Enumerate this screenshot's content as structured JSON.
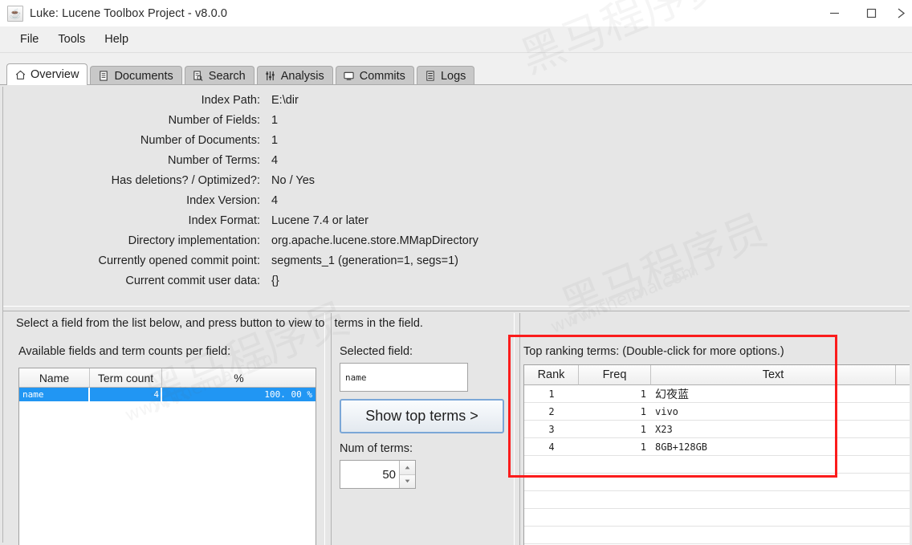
{
  "window": {
    "title": "Luke: Lucene Toolbox Project - v8.0.0",
    "app_icon": "java-coffee-icon",
    "controls": {
      "minimize": "minimize-button",
      "maximize": "maximize-button",
      "close": "close-button"
    }
  },
  "menubar": {
    "items": [
      {
        "label": "File"
      },
      {
        "label": "Tools"
      },
      {
        "label": "Help"
      }
    ]
  },
  "tabs": [
    {
      "label": "Overview",
      "icon": "home-icon",
      "active": true
    },
    {
      "label": "Documents",
      "icon": "document-icon",
      "active": false
    },
    {
      "label": "Search",
      "icon": "search-doc-icon",
      "active": false
    },
    {
      "label": "Analysis",
      "icon": "sliders-icon",
      "active": false
    },
    {
      "label": "Commits",
      "icon": "monitor-icon",
      "active": false
    },
    {
      "label": "Logs",
      "icon": "logs-icon",
      "active": false
    }
  ],
  "overview": {
    "info_rows": [
      {
        "label": "Index Path:",
        "value": "E:\\dir"
      },
      {
        "label": "Number of Fields:",
        "value": "1"
      },
      {
        "label": "Number of Documents:",
        "value": "1"
      },
      {
        "label": "Number of Terms:",
        "value": "4"
      },
      {
        "label": "Has deletions? / Optimized?:",
        "value": "No / Yes"
      },
      {
        "label": "Index Version:",
        "value": "4"
      },
      {
        "label": "Index Format:",
        "value": "Lucene 7.4 or later"
      },
      {
        "label": "Directory implementation:",
        "value": "org.apache.lucene.store.MMapDirectory"
      },
      {
        "label": "Currently opened commit point:",
        "value": "segments_1 (generation=1, segs=1)"
      },
      {
        "label": "Current commit user data:",
        "value": "{}"
      }
    ],
    "hint": "Select a field from the list below, and press button to view top terms in the field.",
    "fields_panel": {
      "label": "Available fields and term counts per field:",
      "columns": [
        "Name",
        "Term count",
        "%"
      ],
      "rows": [
        {
          "name": "name",
          "term_count": "4",
          "percent": "100. 00 %",
          "selected": true
        }
      ]
    },
    "middle_panel": {
      "selected_field_label": "Selected field:",
      "selected_field_value": "name",
      "show_top_terms_label": "Show top terms >",
      "num_of_terms_label": "Num of terms:",
      "num_of_terms_value": "50",
      "spinner_up_icon": "spinner-up-icon",
      "spinner_down_icon": "spinner-down-icon"
    },
    "top_terms_panel": {
      "label": "Top ranking terms: (Double-click for more options.)",
      "columns": [
        "Rank",
        "Freq",
        "Text"
      ],
      "rows": [
        {
          "rank": "1",
          "freq": "1",
          "text": "幻夜蓝",
          "cjk": true
        },
        {
          "rank": "2",
          "freq": "1",
          "text": "vivo",
          "cjk": false
        },
        {
          "rank": "3",
          "freq": "1",
          "text": "X23",
          "cjk": false
        },
        {
          "rank": "4",
          "freq": "1",
          "text": "8GB+128GB",
          "cjk": false
        }
      ]
    }
  },
  "annotation": {
    "type": "red-highlight-rectangle",
    "color": "#fb1c1c",
    "targets": "top-ranking-terms-panel"
  },
  "colors": {
    "selection_blue": "#2196f3",
    "panel_bg": "#e6e6e6",
    "titlebar_bg": "#ffffff",
    "tab_inactive": "#c8c8c8",
    "annotation_red": "#fb1c1c",
    "button_border_blue": "#7ba7d7"
  },
  "watermark": {
    "lines": [
      "黑马程序员",
      "www.itheima.com"
    ]
  }
}
